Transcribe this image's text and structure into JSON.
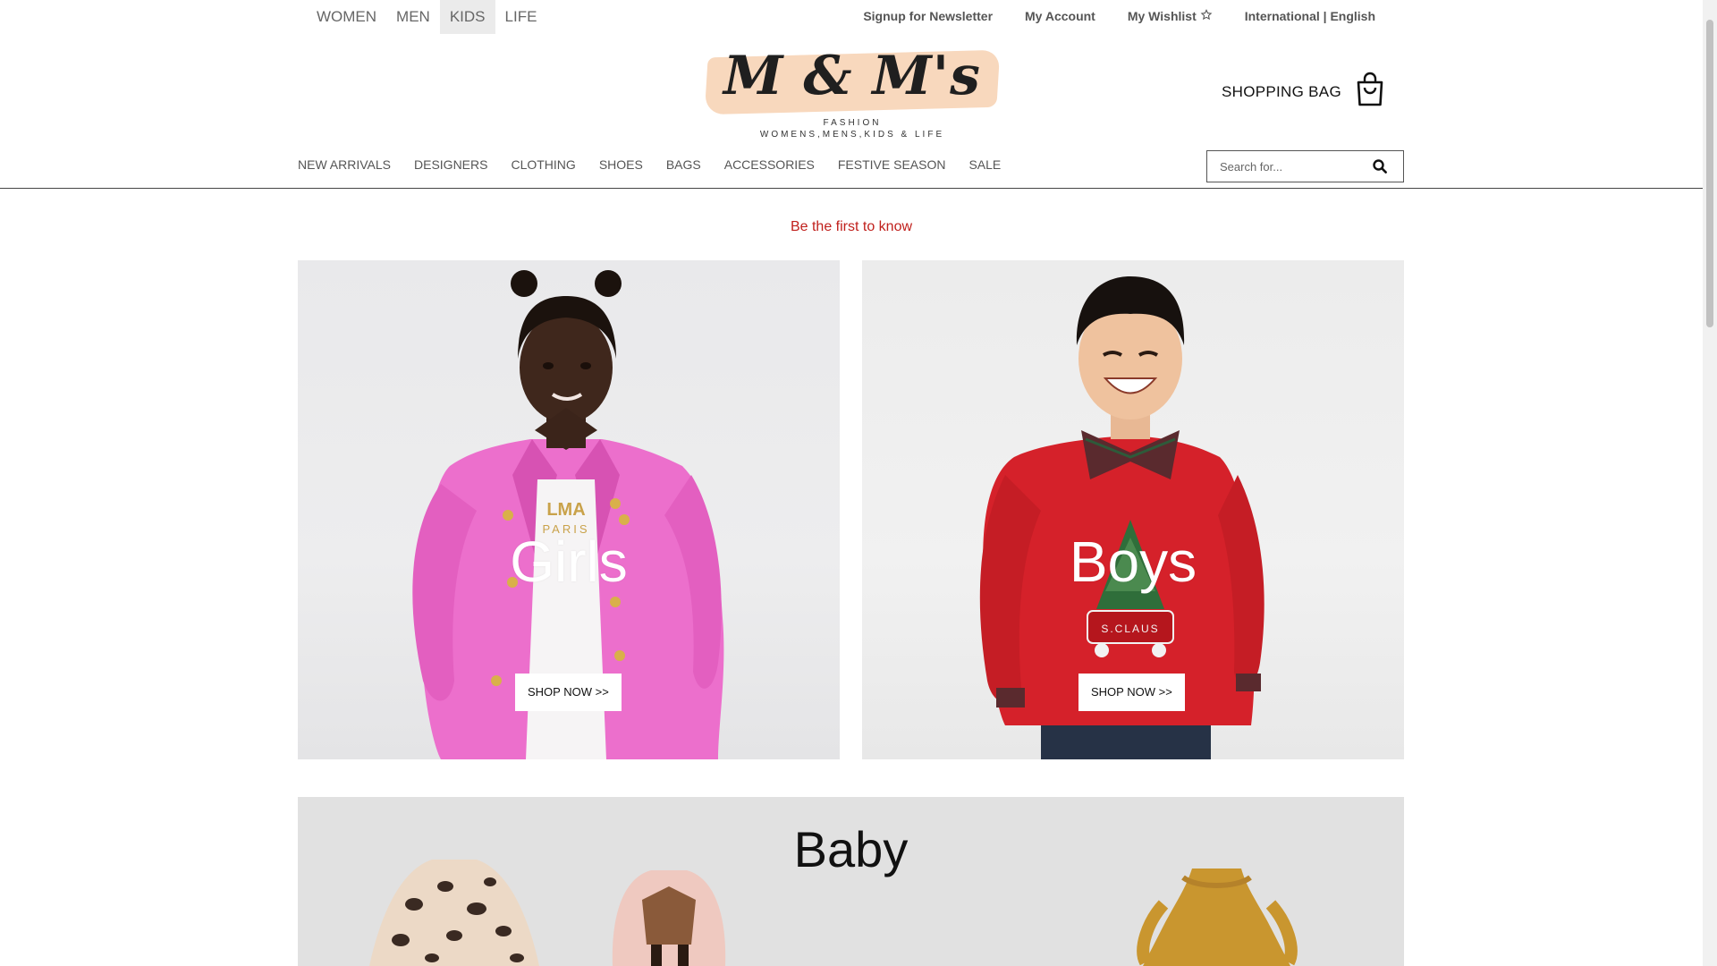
{
  "gender_nav": [
    {
      "label": "WOMEN",
      "active": false
    },
    {
      "label": "MEN",
      "active": false
    },
    {
      "label": "KIDS",
      "active": true
    },
    {
      "label": "LIFE",
      "active": false
    }
  ],
  "utility_nav": {
    "newsletter": "Signup for Newsletter",
    "account": "My Account",
    "wishlist": "My Wishlist",
    "wishlist_icon": "star-icon",
    "locale": "International | English"
  },
  "logo": {
    "wordmark": "M & M's",
    "line1": "FASHION",
    "line2": "WOMENS,MENS,KIDS & LIFE"
  },
  "shopping_bag": {
    "label": "SHOPPING BAG",
    "icon": "shopping-bag-icon"
  },
  "category_nav": [
    "NEW ARRIVALS",
    "DESIGNERS",
    "CLOTHING",
    "SHOES",
    "BAGS",
    "ACCESSORIES",
    "FESTIVE SEASON",
    "SALE"
  ],
  "search": {
    "placeholder": "Search for...",
    "icon": "search-icon"
  },
  "promo": {
    "text": "Be the first to know",
    "color": "#c0201c"
  },
  "tiles": [
    {
      "title": "Girls",
      "button": "SHOP NOW >>"
    },
    {
      "title": "Boys",
      "button": "SHOP NOW >>"
    }
  ],
  "baby": {
    "title": "Baby"
  },
  "colors": {
    "accent": "#c0201c",
    "logo_swash": "#f8d8bd",
    "active_tab_bg": "#ebebeb"
  }
}
